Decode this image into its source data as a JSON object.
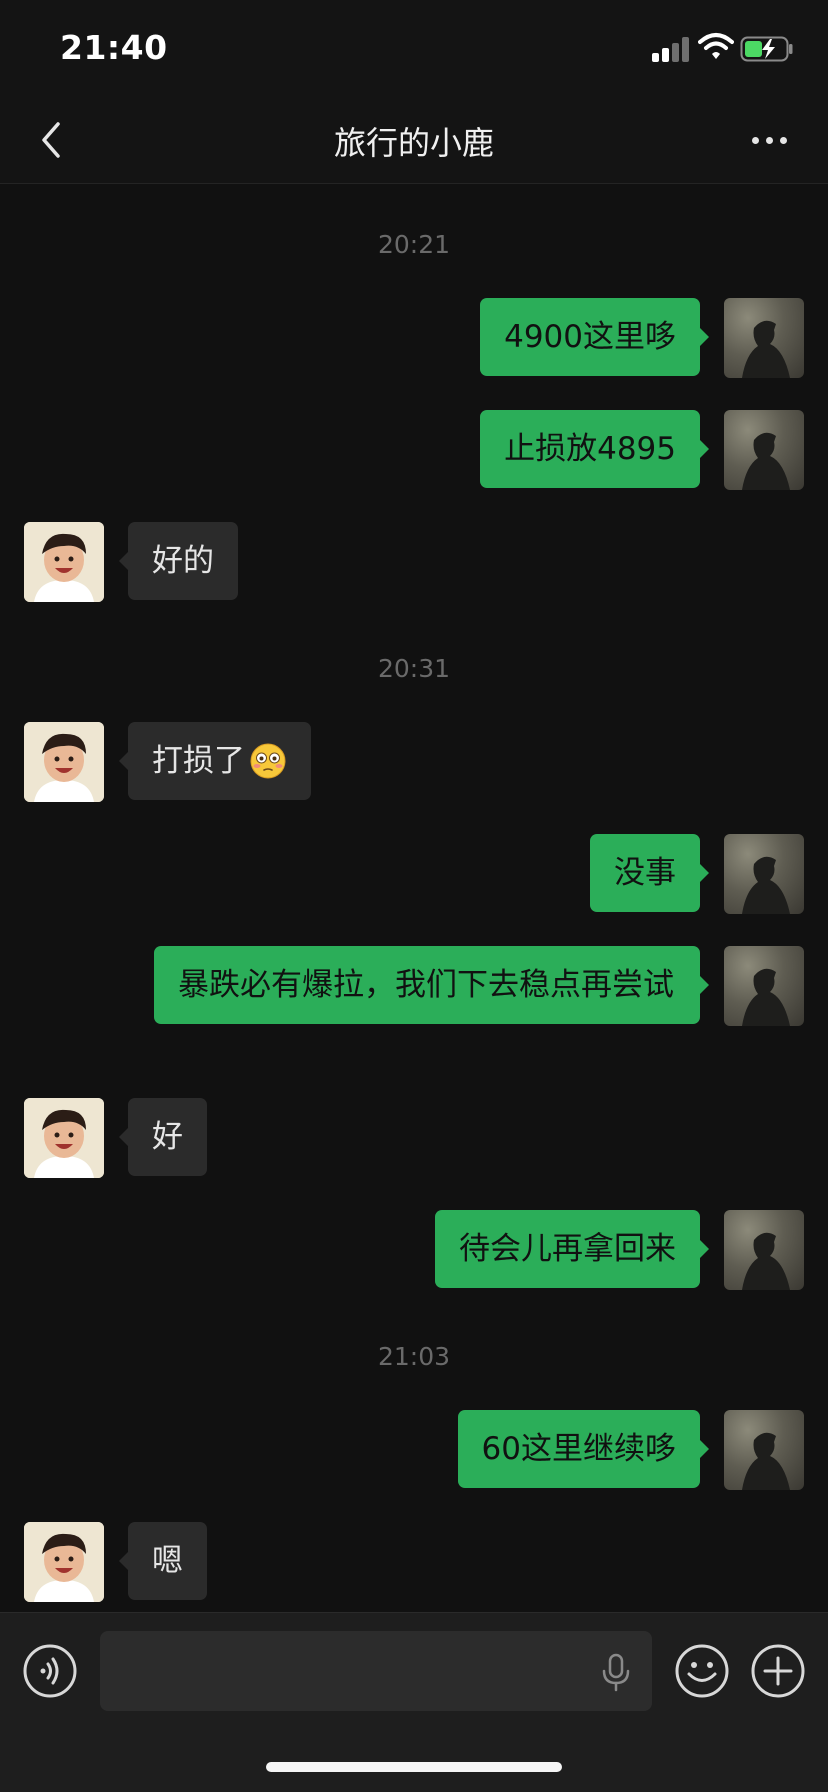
{
  "status_bar": {
    "time": "21:40"
  },
  "nav": {
    "title": "旅行的小鹿",
    "back_icon": "chevron-left-icon",
    "more_icon": "ellipsis-icon"
  },
  "colors": {
    "outgoing_bubble": "#2bae59",
    "incoming_bubble": "#2b2b2b",
    "background": "#111111",
    "battery_charging": "#4cd964"
  },
  "messages": [
    {
      "type": "timestamp",
      "text": "20:21"
    },
    {
      "type": "message",
      "from": "me",
      "text": "4900这里哆"
    },
    {
      "type": "message",
      "from": "me",
      "text": "止损放4895"
    },
    {
      "type": "message",
      "from": "contact",
      "text": "好的"
    },
    {
      "type": "timestamp",
      "text": "20:31"
    },
    {
      "type": "message",
      "from": "contact",
      "text": "打损了",
      "emoji": "flushed-face-emoji"
    },
    {
      "type": "message",
      "from": "me",
      "text": "没事"
    },
    {
      "type": "message",
      "from": "me",
      "text": "暴跌必有爆拉，我们下去稳点再尝试"
    },
    {
      "type": "message",
      "from": "contact",
      "text": "好"
    },
    {
      "type": "message",
      "from": "me",
      "text": "待会儿再拿回来"
    },
    {
      "type": "timestamp",
      "text": "21:03"
    },
    {
      "type": "message",
      "from": "me",
      "text": "60这里继续哆"
    },
    {
      "type": "message",
      "from": "contact",
      "text": "嗯"
    }
  ],
  "input_bar": {
    "value": "",
    "voice_icon": "voice-icon",
    "mic_icon": "microphone-icon",
    "emoji_icon": "smiley-icon",
    "add_icon": "plus-circle-icon"
  }
}
